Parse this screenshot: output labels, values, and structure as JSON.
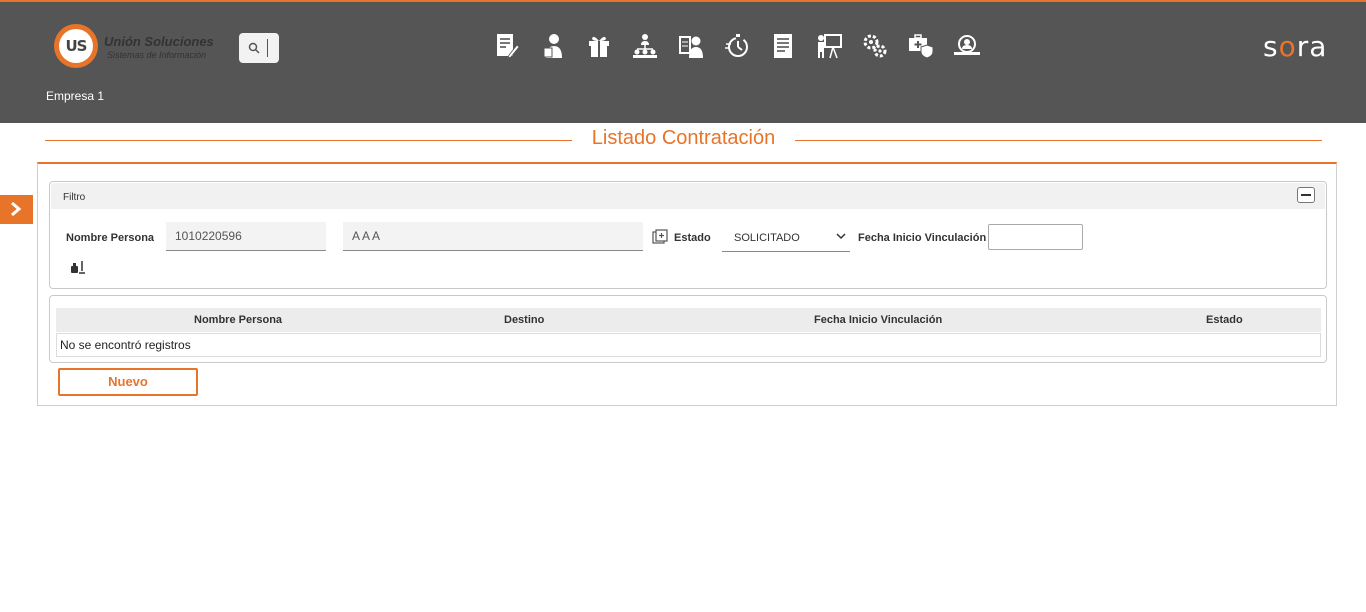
{
  "header": {
    "logo_badge": "US",
    "logo_name": "Unión Soluciones",
    "logo_subtitle": "Sistemas de Información",
    "company": "Empresa 1",
    "brand": "sora",
    "colors": {
      "bar": "#555555",
      "accent": "#e8742a"
    },
    "nav_icons": [
      "contract-edit-icon",
      "user-document-icon",
      "gift-icon",
      "org-chart-icon",
      "employee-id-icon",
      "timer-icon",
      "document-list-icon",
      "presentation-icon",
      "gears-icon",
      "medical-shield-icon",
      "user-search-icon"
    ]
  },
  "page": {
    "title": "Listado Contratación"
  },
  "filter": {
    "title": "Filtro",
    "nombre_persona_label": "Nombre Persona",
    "document_value": "1010220596",
    "name_value": "AAA",
    "estado_label": "Estado",
    "estado_value": "SOLICITADO",
    "fecha_label": "Fecha Inicio Vinculación",
    "fecha_value": ""
  },
  "table": {
    "columns": [
      "Nombre Persona",
      "Destino",
      "Fecha Inicio Vinculación",
      "Estado"
    ],
    "empty_message": "No se encontró registros"
  },
  "actions": {
    "nuevo": "Nuevo"
  }
}
